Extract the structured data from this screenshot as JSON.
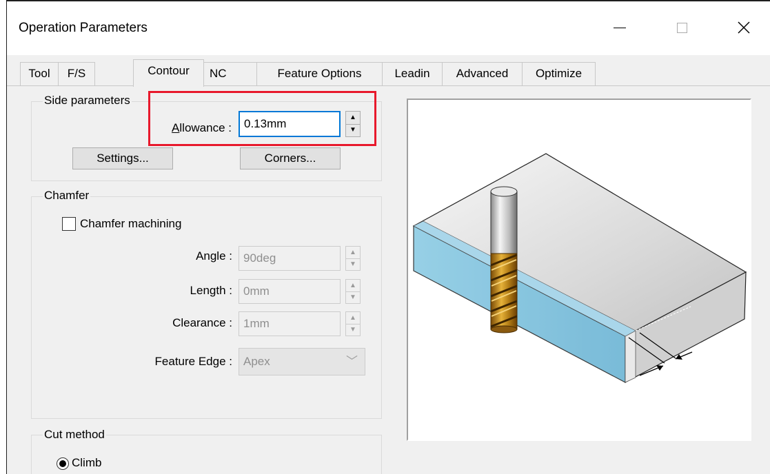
{
  "window": {
    "title": "Operation Parameters",
    "minimize_glyph": "—",
    "maximize_glyph": "☐",
    "close_glyph": "✕"
  },
  "tabs": [
    {
      "label": "Tool",
      "active": false
    },
    {
      "label": "F/S",
      "active": false
    },
    {
      "label": "Contour",
      "active": true
    },
    {
      "label": "NC",
      "active": false
    },
    {
      "label": "Feature Options",
      "active": false
    },
    {
      "label": "Leadin",
      "active": false
    },
    {
      "label": "Advanced",
      "active": false
    },
    {
      "label": "Optimize",
      "active": false
    }
  ],
  "side_parameters": {
    "group_label": "Side parameters",
    "allowance_label": "Allowance :",
    "allowance_value": "0.13mm",
    "settings_button": "Settings...",
    "corners_button": "Corners..."
  },
  "chamfer": {
    "group_label": "Chamfer",
    "checkbox_label": "Chamfer machining",
    "checked": false,
    "angle_label": "Angle :",
    "angle_value": "90deg",
    "length_label": "Length :",
    "length_value": "0mm",
    "clearance_label": "Clearance :",
    "clearance_value": "1mm",
    "feature_edge_label": "Feature Edge :",
    "feature_edge_value": "Apex"
  },
  "cut_method": {
    "group_label": "Cut method",
    "climb_label": "Climb",
    "climb_selected": true
  },
  "colors": {
    "highlight_box": "#e8192c",
    "focus_border": "#0078d7",
    "wall_blue": "#7fc0dc"
  },
  "icons": {
    "spin_up": "▲",
    "spin_down": "▼",
    "dropdown": "﹀"
  }
}
